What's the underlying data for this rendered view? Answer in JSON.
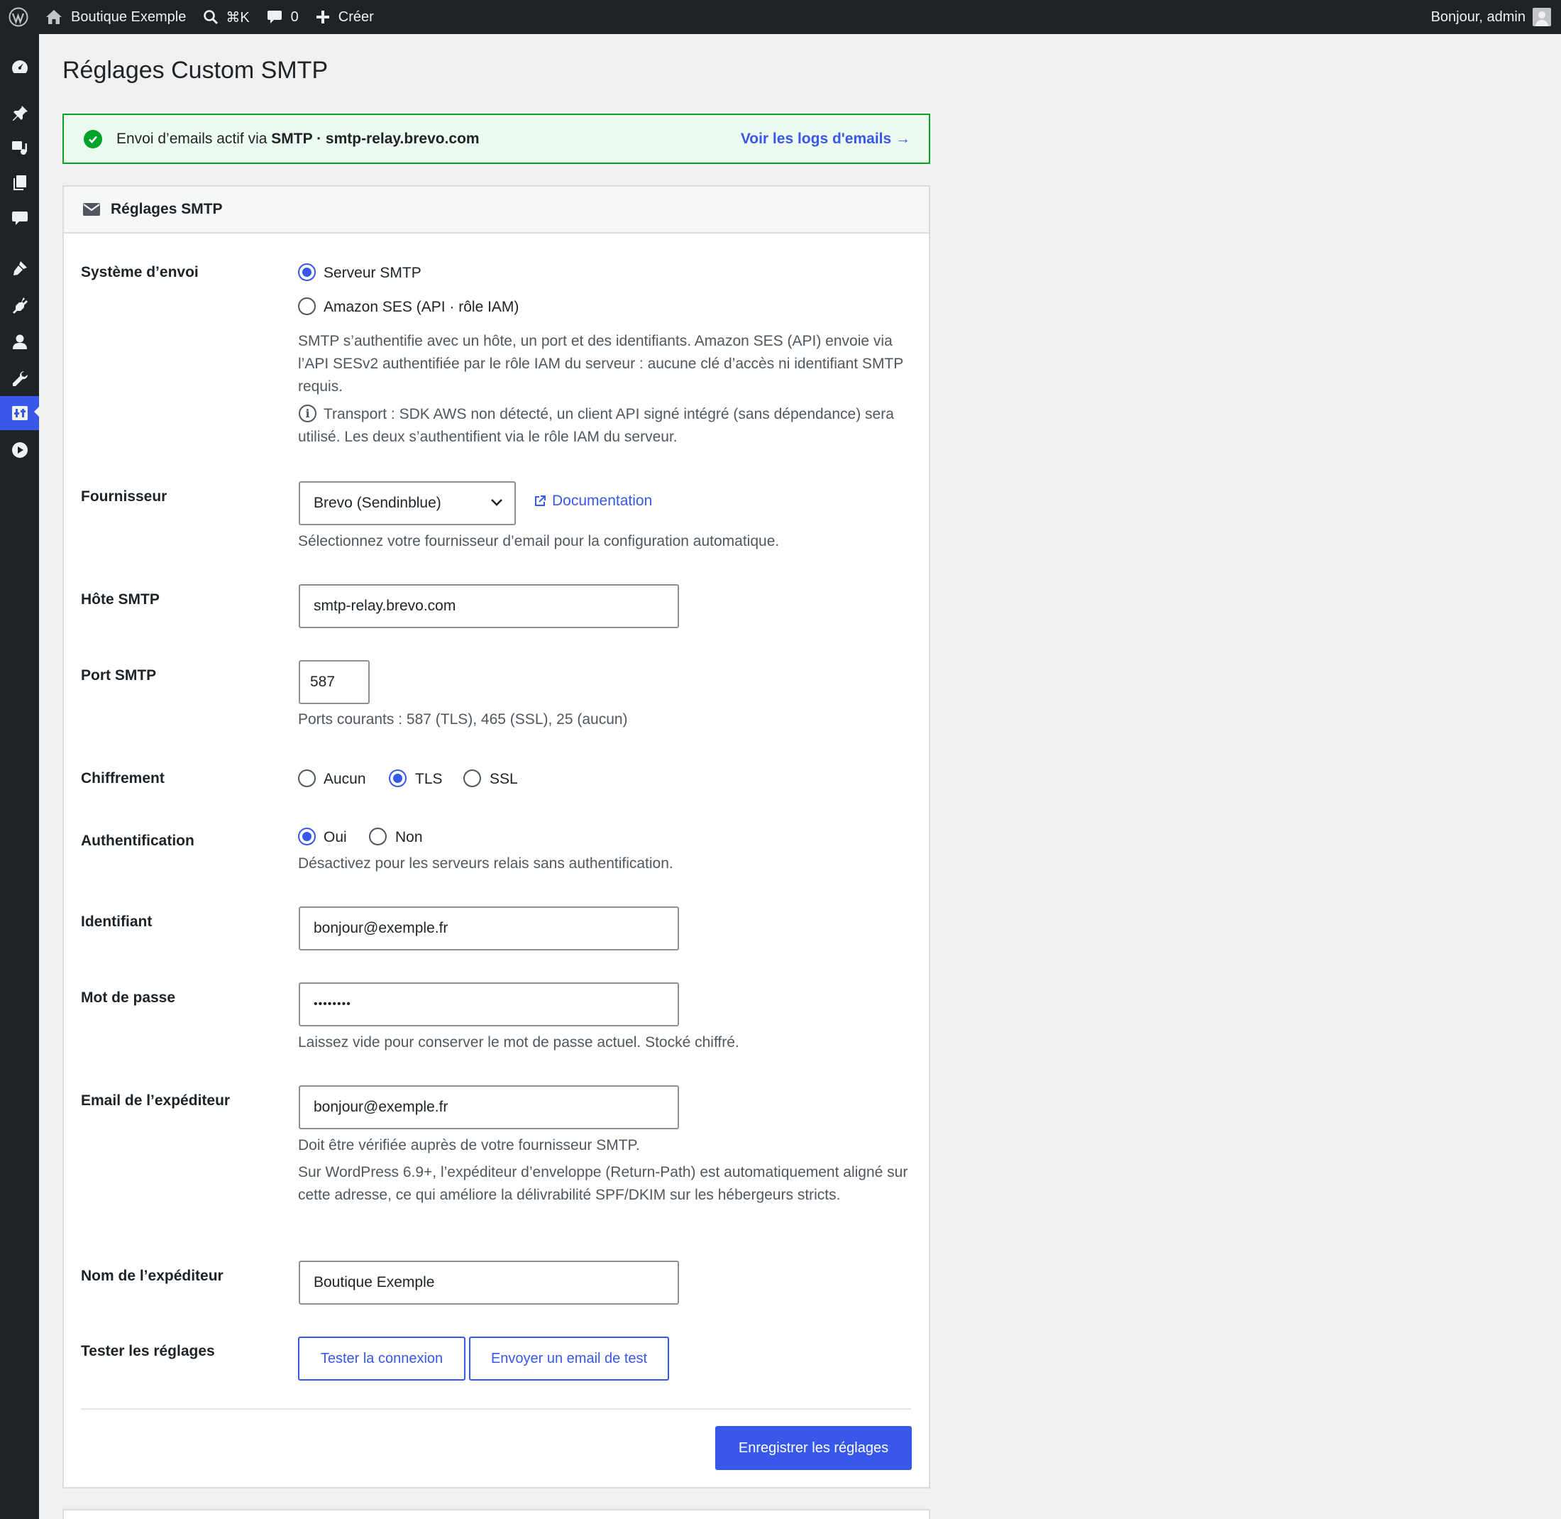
{
  "adminbar": {
    "site_name": "Boutique Exemple",
    "search_shortcut": "⌘K",
    "comments_count": "0",
    "create_label": "Créer",
    "greeting": "Bonjour, admin"
  },
  "sidebar": {
    "icons": [
      "dashboard-icon",
      "pin-icon",
      "media-icon",
      "pages-icon",
      "comments-icon",
      "appearance-icon",
      "plugins-icon",
      "users-icon",
      "tools-icon",
      "settings-icon",
      "play-icon"
    ],
    "active": "settings-icon"
  },
  "page": {
    "title": "Réglages Custom SMTP"
  },
  "notice": {
    "prefix": "Envoi d’emails actif via ",
    "method": "SMTP",
    "separator": " · ",
    "host": "smtp-relay.brevo.com",
    "link_label": "Voir les logs d'emails →"
  },
  "panel": {
    "title": "Réglages SMTP"
  },
  "form": {
    "mailer": {
      "label": "Système d’envoi",
      "options": [
        "Serveur SMTP",
        "Amazon SES (API · rôle IAM)"
      ],
      "selected": "Serveur SMTP",
      "description": "SMTP s’authentifie avec un hôte, un port et des identifiants. Amazon SES (API) envoie via l’API SESv2 authentifiée par le rôle IAM du serveur : aucune clé d’accès ni identifiant SMTP requis.",
      "transport_note": "Transport : SDK AWS non détecté, un client API signé intégré (sans dépendance) sera utilisé. Les deux s’authentifient via le rôle IAM du serveur."
    },
    "provider": {
      "label": "Fournisseur",
      "value": "Brevo (Sendinblue)",
      "doc_link": "Documentation",
      "description": "Sélectionnez votre fournisseur d’email pour la configuration automatique."
    },
    "host": {
      "label": "Hôte SMTP",
      "value": "smtp-relay.brevo.com"
    },
    "port": {
      "label": "Port SMTP",
      "value": "587",
      "description": "Ports courants : 587 (TLS), 465 (SSL), 25 (aucun)"
    },
    "encryption": {
      "label": "Chiffrement",
      "options": [
        "Aucun",
        "TLS",
        "SSL"
      ],
      "selected": "TLS"
    },
    "auth": {
      "label": "Authentification",
      "options": [
        "Oui",
        "Non"
      ],
      "selected": "Oui",
      "description": "Désactivez pour les serveurs relais sans authentification."
    },
    "username": {
      "label": "Identifiant",
      "value": "bonjour@exemple.fr"
    },
    "password": {
      "label": "Mot de passe",
      "value": "••••••••",
      "description": "Laissez vide pour conserver le mot de passe actuel. Stocké chiffré."
    },
    "from_email": {
      "label": "Email de l’expéditeur",
      "value": "bonjour@exemple.fr",
      "description": "Doit être vérifiée auprès de votre fournisseur SMTP.",
      "note": "Sur WordPress 6.9+, l’expéditeur d’enveloppe (Return-Path) est automatiquement aligné sur cette adresse, ce qui améliore la délivrabilité SPF/DKIM sur les hébergeurs stricts."
    },
    "from_name": {
      "label": "Nom de l’expéditeur",
      "value": "Boutique Exemple"
    },
    "test": {
      "label": "Tester les réglages",
      "test_connection": "Tester la connexion",
      "send_test": "Envoyer un email de test"
    },
    "save_label": "Enregistrer les réglages"
  },
  "colors": {
    "accent": "#3858e9",
    "success": "#00a32a",
    "adminbar": "#1d2327"
  }
}
